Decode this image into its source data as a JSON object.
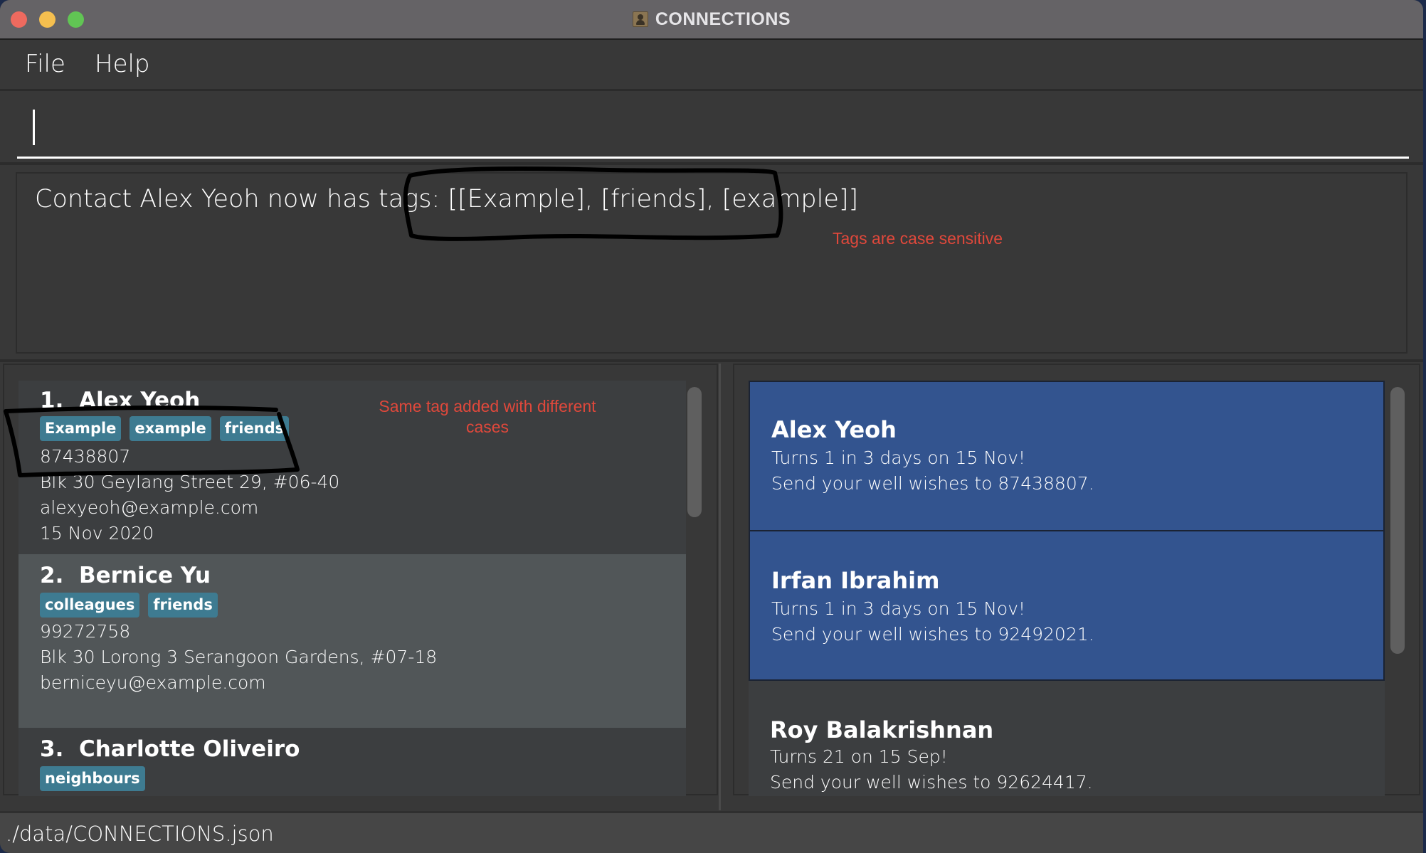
{
  "window": {
    "title": "CONNECTIONS",
    "app_icon": "contact-book-icon",
    "traffic_lights": [
      "close",
      "minimize",
      "maximize"
    ]
  },
  "menu": {
    "items": [
      {
        "label": "File"
      },
      {
        "label": "Help"
      }
    ]
  },
  "command_box": {
    "value": "",
    "placeholder": ""
  },
  "result_display": {
    "text": "Contact Alex Yeoh now has tags: [[Example], [friends], [example]]"
  },
  "annotations": {
    "result_note": "Tags are case sensitive",
    "list_note": "Same tag added with different cases",
    "color": "#e0483b"
  },
  "person_list": {
    "items": [
      {
        "index": "1.",
        "name": "Alex Yeoh",
        "tags": [
          "Example",
          "example",
          "friends"
        ],
        "phone": "87438807",
        "address": "Blk 30 Geylang Street 29, #06-40",
        "email": "alexyeoh@example.com",
        "birthday": "15 Nov 2020"
      },
      {
        "index": "2.",
        "name": "Bernice Yu",
        "tags": [
          "colleagues",
          "friends"
        ],
        "phone": "99272758",
        "address": "Blk 30 Lorong 3 Serangoon Gardens, #07-18",
        "email": "berniceyu@example.com",
        "selected": true
      },
      {
        "index": "3.",
        "name": "Charlotte Oliveiro",
        "tags": [
          "neighbours"
        ]
      }
    ]
  },
  "birthday_list": {
    "items": [
      {
        "name": "Alex Yeoh",
        "line1": "Turns 1 in 3 days on 15 Nov!",
        "line2": "Send your well wishes to 87438807.",
        "upcoming": true
      },
      {
        "name": "Irfan Ibrahim",
        "line1": "Turns 1 in 3 days on 15 Nov!",
        "line2": "Send your well wishes to 92492021.",
        "upcoming": true
      },
      {
        "name": "Roy Balakrishnan",
        "line1": "Turns 21 on 15 Sep!",
        "line2": "Send your well wishes to 92624417.",
        "upcoming": false
      }
    ]
  },
  "status_bar": {
    "file_path": "./data/CONNECTIONS.json"
  },
  "colors": {
    "background": "#383838",
    "tag": "#3e7b91",
    "upcoming_birthday_card": "#33548f",
    "selected_card": "#515658"
  }
}
